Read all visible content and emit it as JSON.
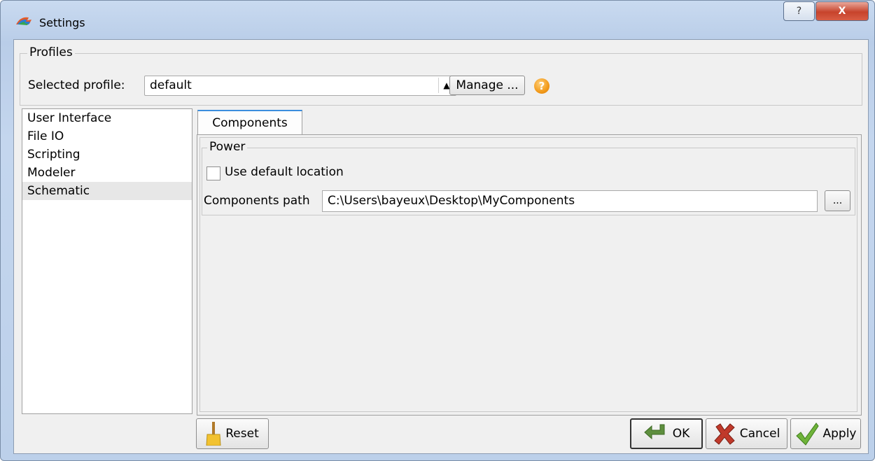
{
  "window": {
    "title": "Settings",
    "help_button": "?",
    "close_button": "X"
  },
  "profiles": {
    "group_title": "Profiles",
    "selected_label": "Selected profile:",
    "selected_value": "default",
    "manage_label": "Manage ...",
    "help_icon": "?"
  },
  "nav": {
    "items": [
      "User Interface",
      "File IO",
      "Scripting",
      "Modeler",
      "Schematic"
    ],
    "selected": "Schematic"
  },
  "tab": {
    "label": "Components"
  },
  "power": {
    "group_title": "Power",
    "use_default_label": "Use default location",
    "use_default_checked": false,
    "path_label": "Components path",
    "path_value": "C:\\Users\\bayeux\\Desktop\\MyComponents",
    "browse_label": "..."
  },
  "buttons": {
    "reset": "Reset",
    "ok": "OK",
    "cancel": "Cancel",
    "apply": "Apply"
  },
  "colors": {
    "tab_accent": "#3b8ede",
    "help_icon": "#f29a1a",
    "close_button": "#c7432c"
  }
}
